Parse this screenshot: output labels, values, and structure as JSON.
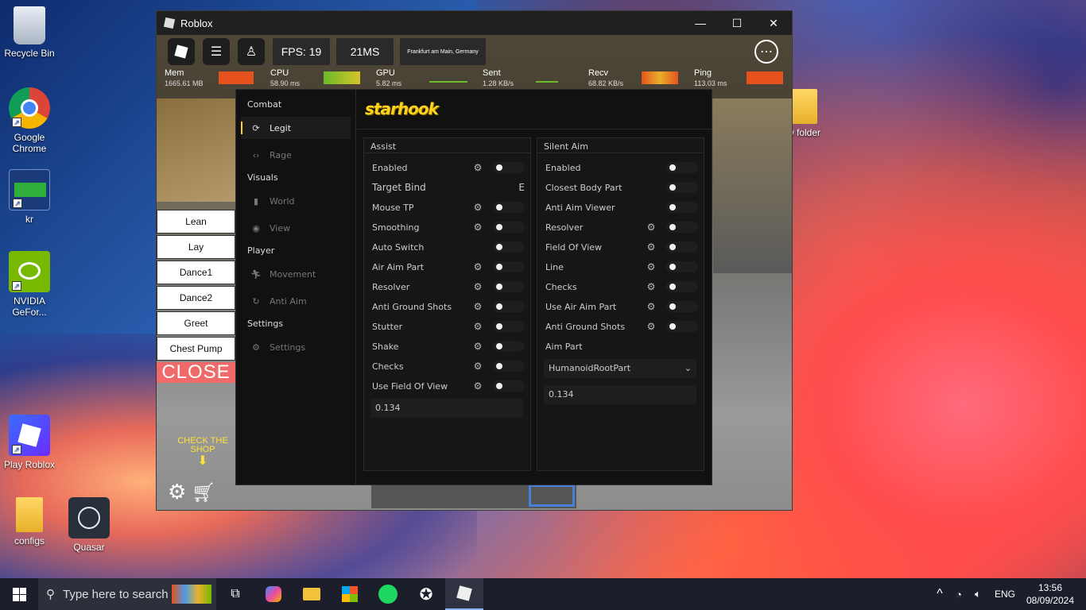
{
  "desktop": {
    "icons": [
      {
        "label": "Recycle Bin"
      },
      {
        "label": "Google Chrome"
      },
      {
        "label": "kr"
      },
      {
        "label": "NVIDIA GeFor..."
      },
      {
        "label": "Play Roblox"
      },
      {
        "label": "configs"
      },
      {
        "label": "Quasar"
      },
      {
        "label": "w folder"
      }
    ]
  },
  "window": {
    "title": "Roblox",
    "minimize": "—",
    "maximize": "☐",
    "close": "✕"
  },
  "hud": {
    "fps": "FPS: 19",
    "ms": "21MS",
    "server": "Frankfurt am Main, Germany",
    "stats": [
      {
        "label": "Mem",
        "value": "1665.61 MB"
      },
      {
        "label": "CPU",
        "value": "58.90 ms"
      },
      {
        "label": "GPU",
        "value": "5.82 ms"
      },
      {
        "label": "Sent",
        "value": "1.28 KB/s"
      },
      {
        "label": "Recv",
        "value": "68.82 KB/s"
      },
      {
        "label": "Ping",
        "value": "113.03 ms"
      }
    ]
  },
  "emotes": [
    "Lean",
    "Lay",
    "Dance1",
    "Dance2",
    "Greet",
    "Chest Pump"
  ],
  "close_label": "CLOSE",
  "shop_note": "CHECK THE SHOP",
  "menu": {
    "brand": "starhook",
    "sections": {
      "combat": "Combat",
      "visuals": "Visuals",
      "player": "Player",
      "settings": "Settings"
    },
    "items": {
      "legit": "Legit",
      "rage": "Rage",
      "world": "World",
      "view": "View",
      "movement": "Movement",
      "anti_aim": "Anti Aim",
      "settings": "Settings"
    },
    "assist": {
      "title": "Assist",
      "rows": [
        "Enabled",
        "Target Bind",
        "Mouse TP",
        "Smoothing",
        "Auto Switch",
        "Air Aim Part",
        "Resolver",
        "Anti Ground Shots",
        "Stutter",
        "Shake",
        "Checks",
        "Use Field Of View"
      ],
      "bind_key": "E",
      "fov_value": "0.134"
    },
    "silent": {
      "title": "Silent Aim",
      "rows": [
        "Enabled",
        "Closest Body Part",
        "Anti Aim Viewer",
        "Resolver",
        "Field Of View",
        "Line",
        "Checks",
        "Use Air Aim Part",
        "Anti Ground Shots",
        "Aim Part"
      ],
      "aim_part": "HumanoidRootPart",
      "fov_value": "0.134"
    }
  },
  "taskbar": {
    "search_placeholder": "Type here to search",
    "lang": "ENG",
    "time": "13:56",
    "date": "08/09/2024"
  }
}
